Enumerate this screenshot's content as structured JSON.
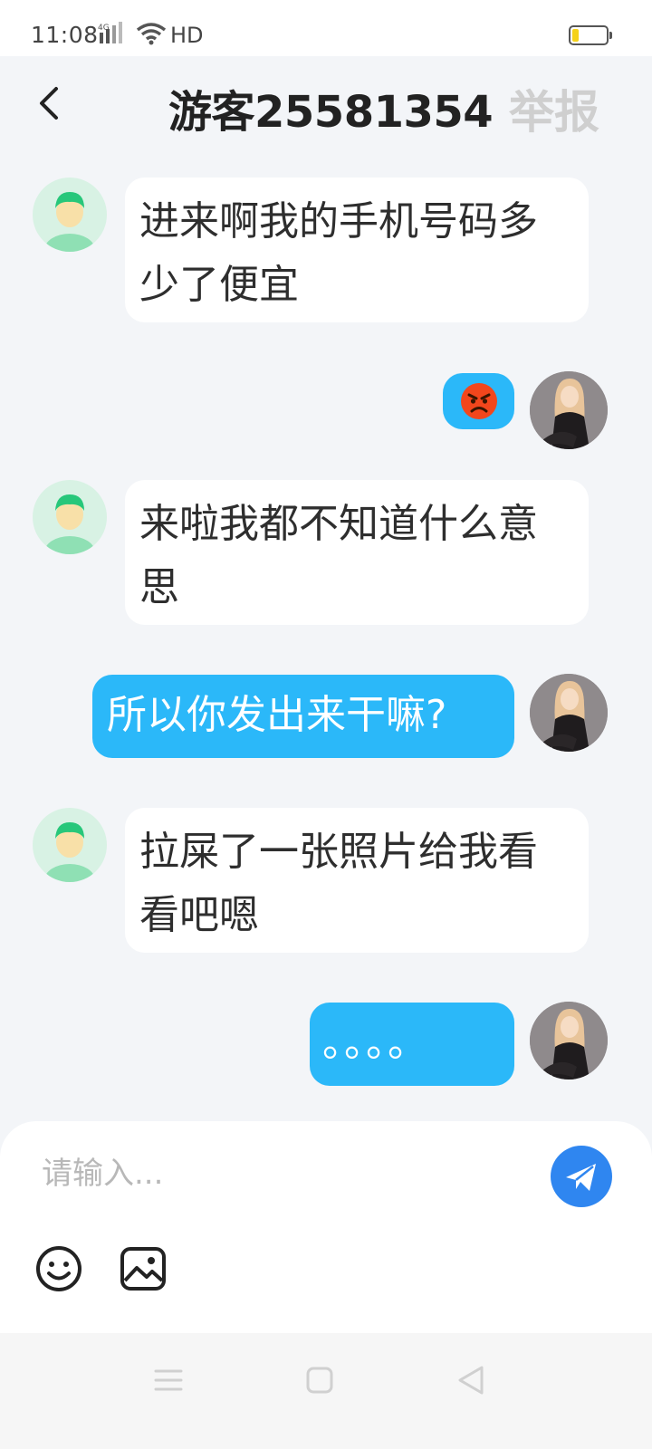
{
  "status_bar": {
    "time": "11:08",
    "network": "4G",
    "hd_label": "HD",
    "battery_level": 0.2,
    "battery_color": "#f5d21a"
  },
  "header": {
    "title": "游客25581354",
    "report_label": "举报"
  },
  "messages": [
    {
      "side": "left",
      "text_line1": "进来啊我的手机号码多",
      "text_line2": "少了便宜"
    },
    {
      "side": "right",
      "type": "emoji",
      "emoji": "😡"
    },
    {
      "side": "left",
      "text_line1": "来啦我都不知道什么意",
      "text_line2": "思"
    },
    {
      "side": "right",
      "text": "所以你发出来干嘛?"
    },
    {
      "side": "left",
      "text_line1": "拉屎了一张照片给我看",
      "text_line2": "看吧嗯"
    },
    {
      "side": "right",
      "text": "。。。。"
    }
  ],
  "input": {
    "placeholder": "请输入..."
  },
  "icons": {
    "send": "send-icon",
    "emoji": "smile-icon",
    "image": "image-icon"
  },
  "colors": {
    "outgoing_bubble": "#2bb8f9",
    "incoming_bubble": "#ffffff",
    "send_button": "#2f86f0",
    "background": "#f3f5f8"
  }
}
